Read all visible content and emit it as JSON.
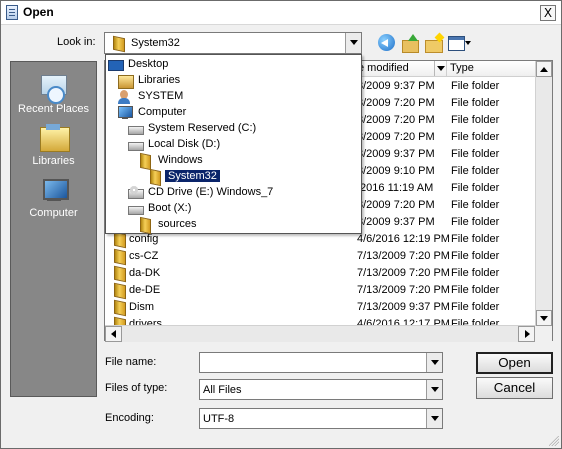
{
  "window": {
    "title": "Open",
    "close": "X"
  },
  "look_in": {
    "label": "Look in:",
    "value": "System32"
  },
  "places": [
    {
      "label": "Recent Places",
      "icon": "recent-places-icon"
    },
    {
      "label": "Libraries",
      "icon": "libraries-icon"
    },
    {
      "label": "Computer",
      "icon": "computer-icon"
    }
  ],
  "file_list": {
    "columns": [
      "e modified",
      "Type"
    ],
    "rows": [
      {
        "date": "3/2009 9:37 PM",
        "type": "File folder"
      },
      {
        "date": "3/2009 7:20 PM",
        "type": "File folder"
      },
      {
        "date": "3/2009 7:20 PM",
        "type": "File folder"
      },
      {
        "date": "3/2009 7:20 PM",
        "type": "File folder"
      },
      {
        "date": "3/2009 9:37 PM",
        "type": "File folder"
      },
      {
        "date": "3/2009 9:10 PM",
        "type": "File folder"
      },
      {
        "date": "/2016 11:19 AM",
        "type": "File folder"
      },
      {
        "date": "3/2009 7:20 PM",
        "type": "File folder"
      },
      {
        "date": "3/2009 9:37 PM",
        "type": "File folder"
      },
      {
        "name": "config",
        "date": "4/6/2016 12:19 PM",
        "type": "File folder"
      },
      {
        "name": "cs-CZ",
        "date": "7/13/2009 7:20 PM",
        "type": "File folder"
      },
      {
        "name": "da-DK",
        "date": "7/13/2009 7:20 PM",
        "type": "File folder"
      },
      {
        "name": "de-DE",
        "date": "7/13/2009 7:20 PM",
        "type": "File folder"
      },
      {
        "name": "Dism",
        "date": "7/13/2009 9:37 PM",
        "type": "File folder"
      },
      {
        "name": "drivers",
        "date": "4/6/2016 12:17 PM",
        "type": "File folder"
      }
    ]
  },
  "look_in_dropdown": {
    "items": [
      {
        "label": "Desktop",
        "icon": "desktop-icon"
      },
      {
        "label": "Libraries",
        "icon": "libraries-icon"
      },
      {
        "label": "SYSTEM",
        "icon": "user-icon"
      },
      {
        "label": "Computer",
        "icon": "computer-icon"
      },
      {
        "label": "System Reserved (C:)",
        "icon": "drive-icon"
      },
      {
        "label": "Local Disk (D:)",
        "icon": "drive-icon"
      },
      {
        "label": "Windows",
        "icon": "folder-icon"
      },
      {
        "label": "System32",
        "icon": "folder-icon",
        "selected": true
      },
      {
        "label": "CD Drive (E:) Windows_7",
        "icon": "cd-drive-icon"
      },
      {
        "label": "Boot (X:)",
        "icon": "drive-icon"
      },
      {
        "label": "sources",
        "icon": "folder-icon"
      }
    ]
  },
  "fields": {
    "file_name_label": "File name:",
    "file_name_value": "",
    "files_of_type_label": "Files of type:",
    "files_of_type_value": "All Files",
    "encoding_label": "Encoding:",
    "encoding_value": "UTF-8"
  },
  "buttons": {
    "open": "Open",
    "cancel": "Cancel"
  },
  "colors": {
    "selection": "#0a246a",
    "places_background": "#878787",
    "folder": "#f5cf57"
  }
}
